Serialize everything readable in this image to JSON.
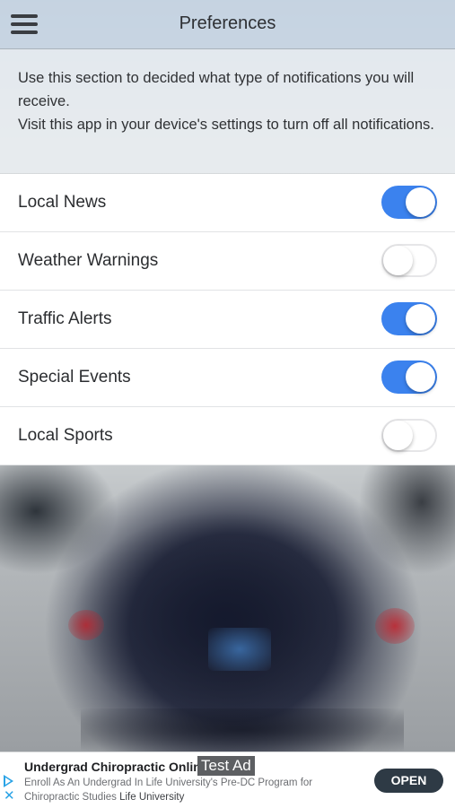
{
  "header": {
    "title": "Preferences",
    "menu_icon": "hamburger-menu-icon"
  },
  "intro": {
    "line1": "Use this section to decided what type of notifications you will receive.",
    "line2": "Visit this app in your device's settings to turn off all notifications."
  },
  "settings": [
    {
      "label": "Local News",
      "on": true
    },
    {
      "label": "Weather Warnings",
      "on": false
    },
    {
      "label": "Traffic Alerts",
      "on": true
    },
    {
      "label": "Special Events",
      "on": true
    },
    {
      "label": "Local Sports",
      "on": false
    }
  ],
  "colors": {
    "toggle_on": "#3b82ee",
    "nav_bar": "#c8d6e4"
  },
  "ad": {
    "title": "Undergrad Chiropractic Online",
    "badge": "Test Ad",
    "description": "Enroll As An Undergrad In Life University's Pre-DC Program for Chiropractic Studies",
    "advertiser": "Life University",
    "cta": "OPEN",
    "icons": [
      "ad-choices-play-icon",
      "ad-close-icon"
    ]
  }
}
